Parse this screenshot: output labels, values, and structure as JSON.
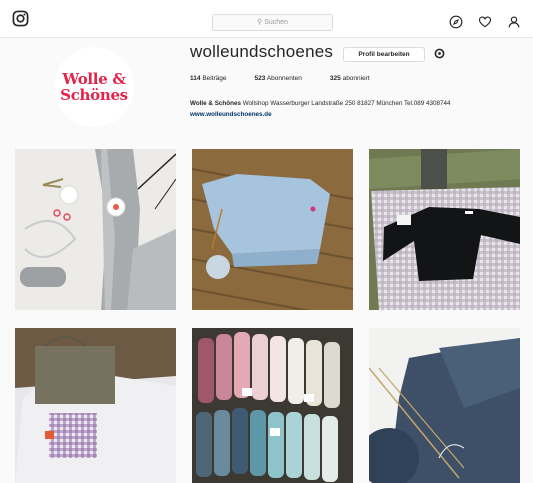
{
  "header": {
    "logo_icon": "instagram-icon",
    "search_placeholder": "Suchen",
    "icons": [
      "compass-icon",
      "heart-icon",
      "user-icon"
    ]
  },
  "profile": {
    "avatar_line1": "Wolle &",
    "avatar_line2": "Schönes",
    "username": "wolleundschoenes",
    "edit_label": "Profil bearbeiten",
    "stats": [
      {
        "value": "114",
        "label": "Beiträge"
      },
      {
        "value": "523",
        "label": "Abonnenten"
      },
      {
        "value": "325",
        "label": "abonniert"
      }
    ],
    "bio_name": "Wolle & Schönes",
    "bio_text": "Wollshop Wasserburger Landstraße 250 81827 München Tel.089 4308744",
    "bio_link": "www.wolleundschoenes.de"
  },
  "colors": {
    "brand_red": "#e4234b",
    "link": "#003569"
  },
  "posts": [
    {
      "subject": "grey knitting with tools"
    },
    {
      "subject": "light blue sweater on wooden deck"
    },
    {
      "subject": "black sweater on gingham"
    },
    {
      "subject": "gift bag with gingham tag"
    },
    {
      "subject": "colorful yarn skeins"
    },
    {
      "subject": "navy knit with needles"
    }
  ]
}
